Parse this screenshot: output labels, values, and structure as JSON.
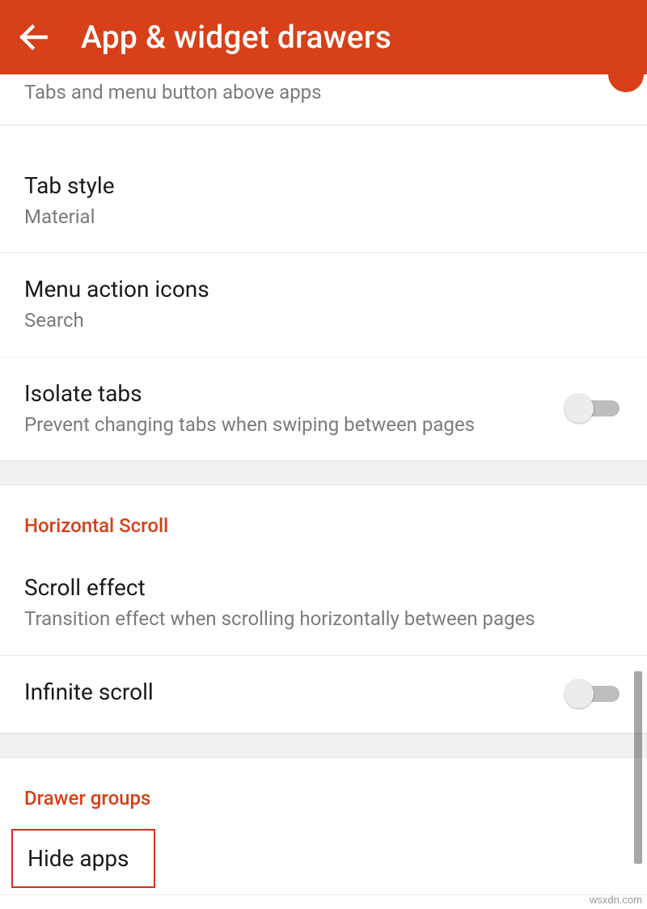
{
  "toolbar": {
    "title": "App & widget drawers"
  },
  "partial": {
    "subtitle": "Tabs and menu button above apps"
  },
  "items": {
    "tab_style": {
      "title": "Tab style",
      "value": "Material"
    },
    "menu_action": {
      "title": "Menu action icons",
      "value": "Search"
    },
    "isolate": {
      "title": "Isolate tabs",
      "subtitle": "Prevent changing tabs when swiping between pages"
    },
    "scroll_effect": {
      "title": "Scroll effect",
      "subtitle": "Transition effect when scrolling horizontally between pages"
    },
    "infinite": {
      "title": "Infinite scroll"
    },
    "hide_apps": {
      "title": "Hide apps"
    }
  },
  "sections": {
    "horizontal_scroll": "Horizontal Scroll",
    "drawer_groups": "Drawer groups"
  },
  "watermark": "wsxdn.com"
}
